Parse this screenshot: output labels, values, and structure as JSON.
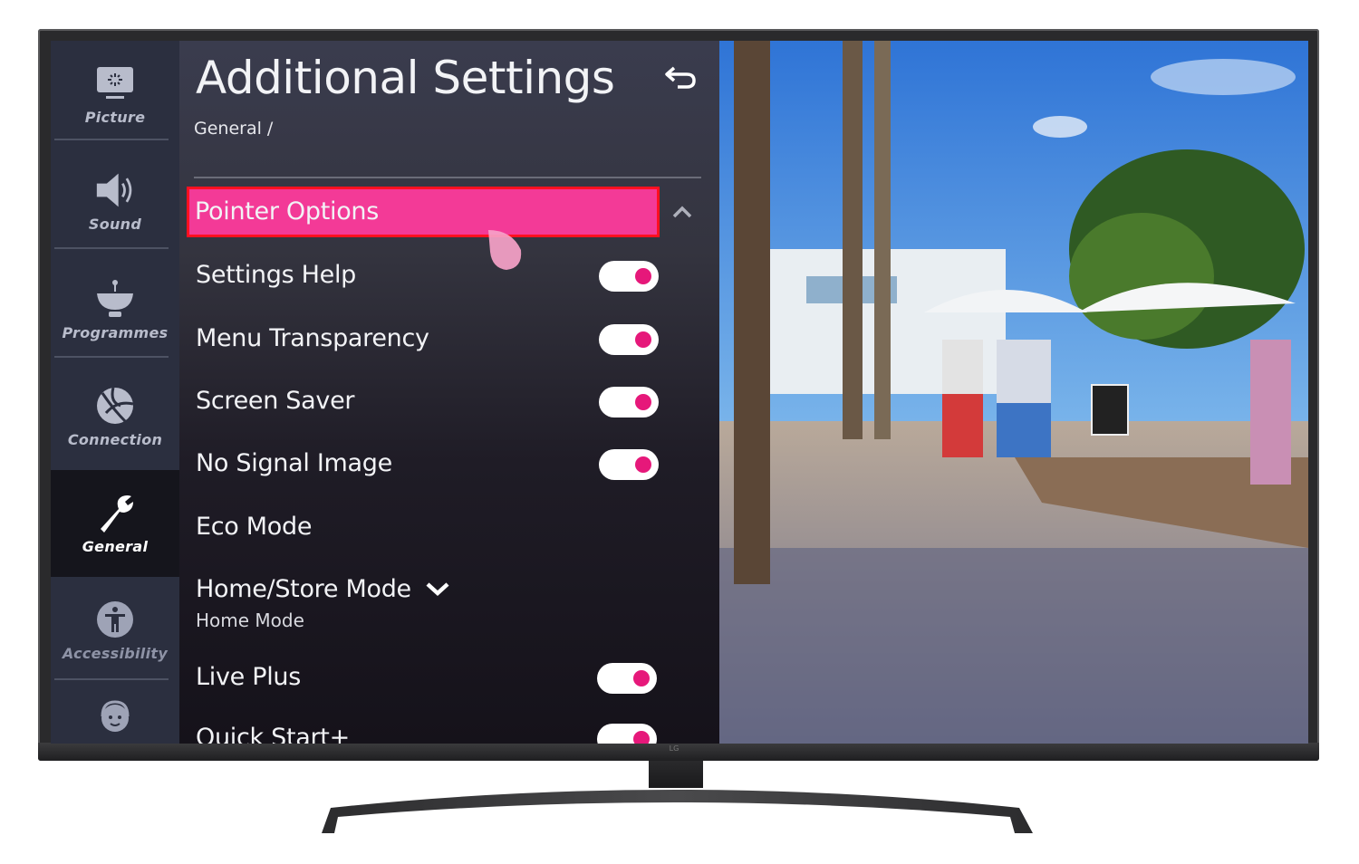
{
  "sidebar": {
    "items": [
      {
        "label": "Picture",
        "icon": "picture-icon",
        "active": false
      },
      {
        "label": "Sound",
        "icon": "speaker-icon",
        "active": false
      },
      {
        "label": "Programmes",
        "icon": "satellite-dish-icon",
        "active": false
      },
      {
        "label": "Connection",
        "icon": "globe-icon",
        "active": false
      },
      {
        "label": "General",
        "icon": "wrench-icon",
        "active": true
      },
      {
        "label": "Accessibility",
        "icon": "accessibility-icon",
        "active": false
      },
      {
        "label": "",
        "icon": "support-headset-icon",
        "active": false
      }
    ]
  },
  "panel": {
    "title": "Additional Settings",
    "breadcrumb": "General /",
    "back_icon": "back-arrow-icon",
    "items": [
      {
        "label": "Pointer Options",
        "type": "expandable",
        "expanded": true,
        "focused": true
      },
      {
        "label": "Settings Help",
        "type": "toggle",
        "on": true
      },
      {
        "label": "Menu Transparency",
        "type": "toggle",
        "on": true
      },
      {
        "label": "Screen Saver",
        "type": "toggle",
        "on": true
      },
      {
        "label": "No Signal Image",
        "type": "toggle",
        "on": true
      },
      {
        "label": "Eco Mode",
        "type": "link"
      },
      {
        "label": "Home/Store Mode",
        "type": "dropdown",
        "value": "Home Mode"
      },
      {
        "label": "Live Plus",
        "type": "toggle",
        "on": true
      },
      {
        "label": "Quick Start+",
        "type": "toggle",
        "on": true
      }
    ]
  },
  "tv": {
    "brand": "LG"
  },
  "colors": {
    "accent": "#f33a97",
    "toggle_knob": "#e6187a",
    "highlight_border": "#ff1020",
    "sidebar_bg": "#2b2f3f"
  }
}
